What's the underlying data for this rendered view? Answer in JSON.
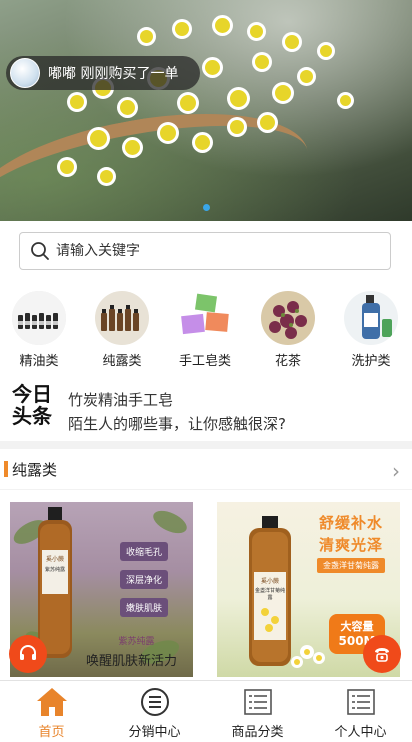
{
  "banner": {
    "notice_text": "嘟嘟 刚刚购买了一单",
    "active_dot_color": "#3aa6e8"
  },
  "search": {
    "placeholder": "请输入关键字"
  },
  "categories": [
    {
      "label": "精油类",
      "icon": "essential-oil-bottles"
    },
    {
      "label": "纯露类",
      "icon": "hydrosol-bottles"
    },
    {
      "label": "手工皂类",
      "icon": "handmade-soaps"
    },
    {
      "label": "花茶",
      "icon": "flower-tea"
    },
    {
      "label": "洗护类",
      "icon": "shampoo-bottle"
    }
  ],
  "headline": {
    "badge_line1": "今日",
    "badge_line2": "头条",
    "items": [
      "竹炭精油手工皂",
      "陌生人的哪些事，让你感触很深?"
    ]
  },
  "section": {
    "title": "纯露类",
    "accent_color": "#ef8a2a"
  },
  "products": [
    {
      "brand": "奚小蕨",
      "bottle_label": "紫苏纯露",
      "tags": [
        "收缩毛孔",
        "深层净化",
        "嫩肤肌肤"
      ],
      "caption_small": "紫苏纯露",
      "caption_big": "唤醒肌肤新活力"
    },
    {
      "brand": "奚小蕨",
      "bottle_label": "金盏洋甘菊纯露",
      "headline1": "舒缓补水",
      "headline2": "清爽光泽",
      "ribbon": "金盏洋甘菊纯露",
      "badge_line1": "大容量",
      "badge_line2": "500M"
    }
  ],
  "tabbar": {
    "accent_color": "#e8842b",
    "tabs": [
      {
        "label": "首页",
        "icon": "home-icon"
      },
      {
        "label": "分销中心",
        "icon": "list-circle-icon"
      },
      {
        "label": "商品分类",
        "icon": "list-doc-icon"
      },
      {
        "label": "个人中心",
        "icon": "list-doc-icon"
      }
    ]
  }
}
